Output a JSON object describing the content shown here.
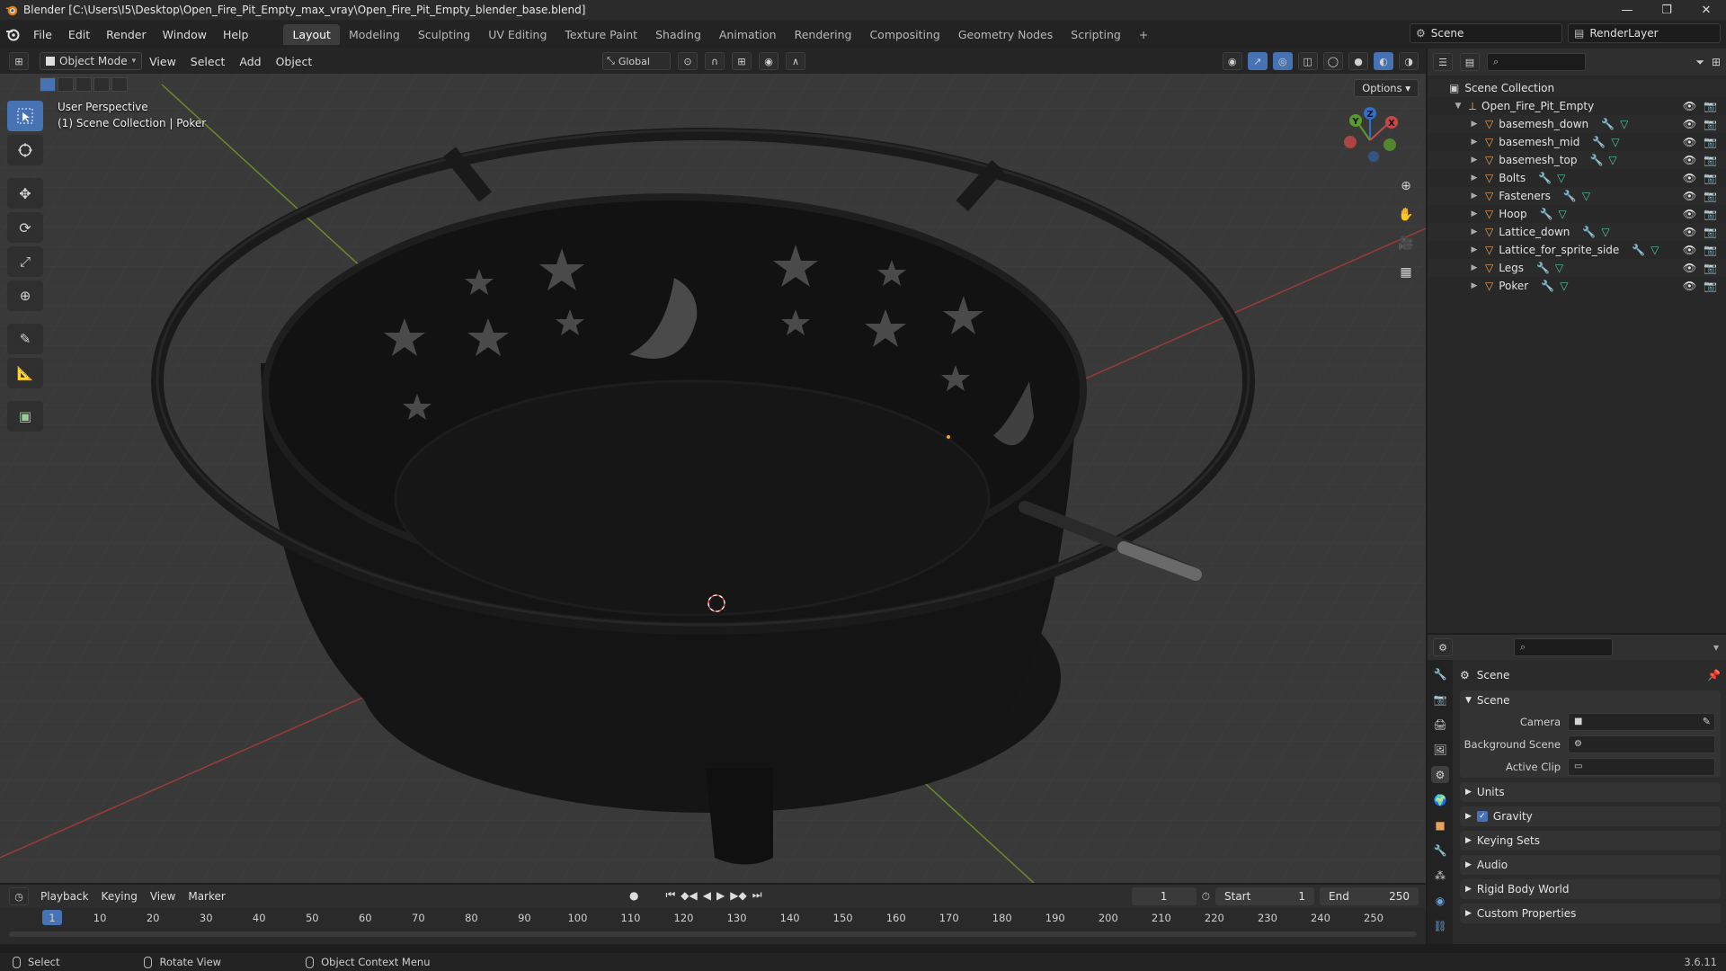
{
  "window": {
    "title": "Blender [C:\\Users\\I5\\Desktop\\Open_Fire_Pit_Empty_max_vray\\Open_Fire_Pit_Empty_blender_base.blend]",
    "controls": [
      "—",
      "❐",
      "✕"
    ]
  },
  "menubar": {
    "items": [
      "File",
      "Edit",
      "Render",
      "Window",
      "Help"
    ],
    "workspaces": [
      "Layout",
      "Modeling",
      "Sculpting",
      "UV Editing",
      "Texture Paint",
      "Shading",
      "Animation",
      "Rendering",
      "Compositing",
      "Geometry Nodes",
      "Scripting"
    ],
    "active_workspace": "Layout",
    "add_tab": "+",
    "scene": "Scene",
    "view_layer": "RenderLayer"
  },
  "viewport": {
    "mode": "Object Mode",
    "menus": [
      "View",
      "Select",
      "Add",
      "Object"
    ],
    "orientation": "Global",
    "options": "Options",
    "info_line1": "User Perspective",
    "info_line2": "(1) Scene Collection | Poker",
    "gizmo": {
      "x": "X",
      "y": "Y",
      "z": "Z"
    },
    "colors": {
      "background": "#393939",
      "grid": "#4a4a4a",
      "x_axis": "#9a3b3b",
      "y_axis": "#6b8a2a",
      "accent": "#4772b3"
    }
  },
  "outliner": {
    "root": "Scene Collection",
    "collection": "Open_Fire_Pit_Empty",
    "objects": [
      "basemesh_down",
      "basemesh_mid",
      "basemesh_top",
      "Bolts",
      "Fasteners",
      "Hoop",
      "Lattice_down",
      "Lattice_for_sprite_side",
      "Legs",
      "Poker"
    ]
  },
  "properties": {
    "context": "Scene",
    "panel_title": "Scene",
    "fields": [
      {
        "label": "Camera",
        "value": ""
      },
      {
        "label": "Background Scene",
        "value": ""
      },
      {
        "label": "Active Clip",
        "value": ""
      }
    ],
    "subpanels": [
      "Units",
      "Gravity",
      "Keying Sets",
      "Audio",
      "Rigid Body World",
      "Custom Properties"
    ],
    "gravity_checked": true
  },
  "timeline": {
    "menus": [
      "Playback",
      "Keying",
      "View",
      "Marker"
    ],
    "current_frame": "1",
    "start_label": "Start",
    "start": "1",
    "end_label": "End",
    "end": "250",
    "ruler": [
      "1",
      "10",
      "20",
      "30",
      "40",
      "50",
      "60",
      "70",
      "80",
      "90",
      "100",
      "110",
      "120",
      "130",
      "140",
      "150",
      "160",
      "170",
      "180",
      "190",
      "200",
      "210",
      "220",
      "230",
      "240",
      "250"
    ]
  },
  "statusbar": {
    "items": [
      "Select",
      "Rotate View",
      "Object Context Menu"
    ],
    "version": "3.6.11"
  }
}
